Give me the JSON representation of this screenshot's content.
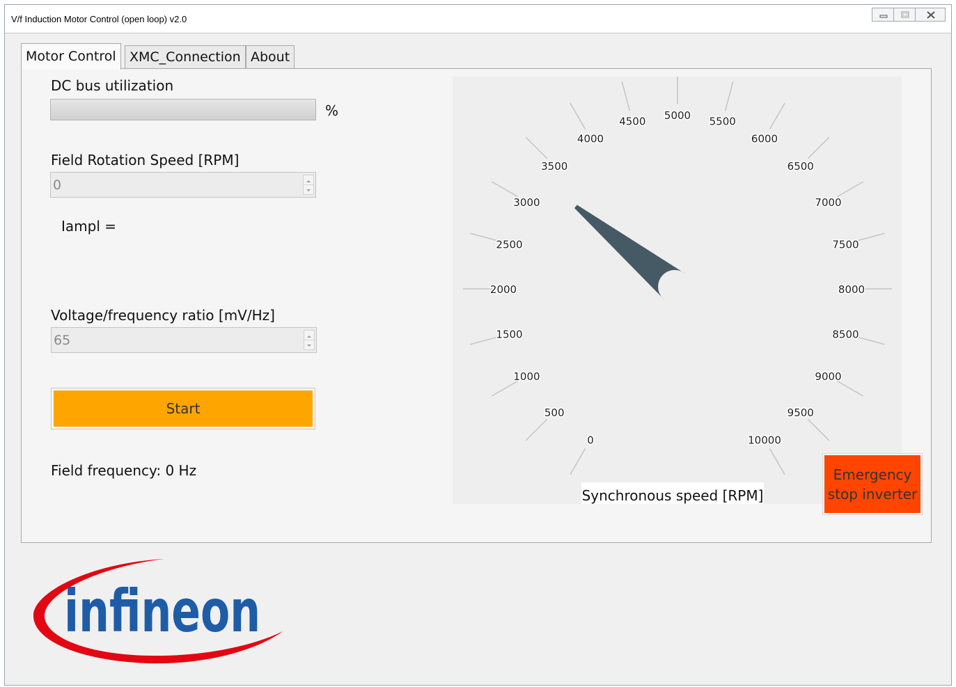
{
  "window": {
    "title": "V/f Induction Motor Control (open loop) v2.0",
    "controls": [
      "minimize-icon",
      "maximize-icon",
      "close-icon"
    ]
  },
  "tabs": [
    {
      "label": "Motor Control",
      "active": true
    },
    {
      "label": "XMC_Connection",
      "active": false
    },
    {
      "label": "About",
      "active": false
    }
  ],
  "motor_control": {
    "dc_bus_label": "DC bus utilization",
    "dc_bus_unit": "%",
    "dc_bus_value_percent": 0,
    "field_speed_label": "Field Rotation Speed [RPM]",
    "field_speed_value": "0",
    "iampl_label": "Iampl =",
    "vf_ratio_label": "Voltage/frequency ratio [mV/Hz]",
    "vf_ratio_value": "65",
    "start_label": "Start",
    "field_freq_label": "Field frequency: 0 Hz",
    "emergency_label": "Emergency\nstop inverter"
  },
  "gauge": {
    "title": "Synchronous speed [RPM]",
    "min": 0,
    "max": 10000,
    "step": 500,
    "ticks": [
      "0",
      "500",
      "1000",
      "1500",
      "2000",
      "2500",
      "3000",
      "3500",
      "4000",
      "4500",
      "5000",
      "5500",
      "6000",
      "6500",
      "7000",
      "7500",
      "8000",
      "8500",
      "9000",
      "9500",
      "10000"
    ],
    "needle_value": 3300,
    "needle_color": "#455a64"
  },
  "colors": {
    "start": "#ffa500",
    "emergency": "#ff4500",
    "logo_blue": "#1f5ca8",
    "logo_red": "#e30613"
  },
  "logo": {
    "text": "infineon"
  }
}
